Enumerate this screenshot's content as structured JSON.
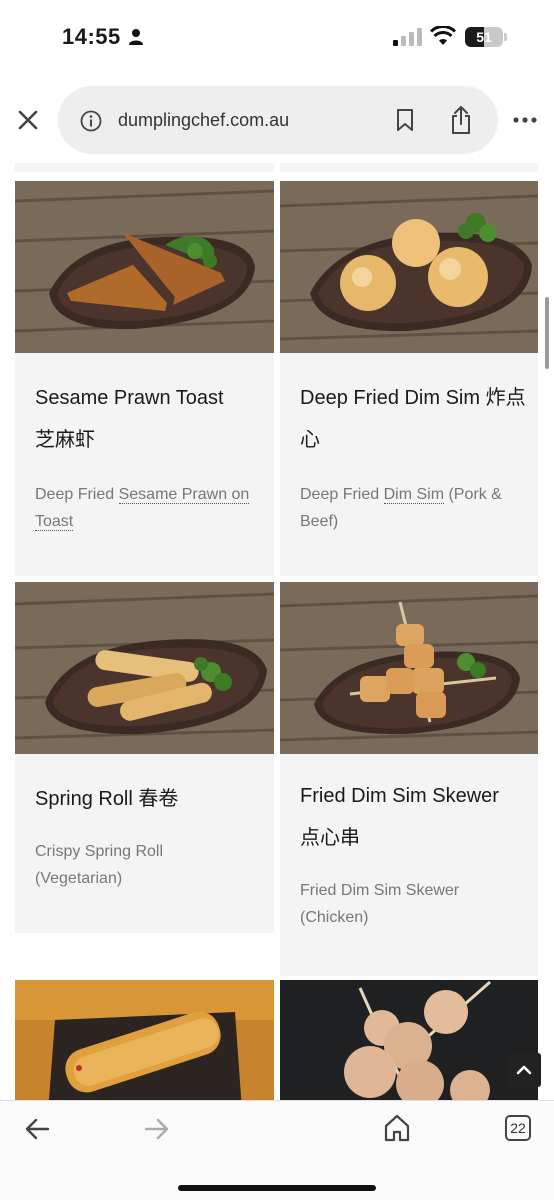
{
  "status": {
    "time": "14:55",
    "battery": "51",
    "battery_level": 0.51,
    "icons": [
      "person-icon",
      "signal-icon",
      "wifi-icon",
      "battery-icon"
    ]
  },
  "browser": {
    "url": "dumplingchef.com.au",
    "tabs_count": "22",
    "icons": [
      "close-icon",
      "info-icon",
      "bookmark-icon",
      "share-icon",
      "more-icon",
      "back-arrow-icon",
      "forward-arrow-icon",
      "home-icon",
      "scroll-top-icon"
    ]
  },
  "menu": {
    "items": [
      {
        "title": "Sesame Prawn Toast",
        "title_cn": "芝麻虾",
        "desc_prefix": "Deep Fried ",
        "desc_link": "Sesame Prawn on Toast",
        "desc_suffix": ""
      },
      {
        "title": "Deep Fried Dim Sim",
        "title_cn": "炸点心",
        "desc_prefix": "Deep Fried ",
        "desc_link": "Dim Sim",
        "desc_suffix": " (Pork & Beef)"
      },
      {
        "title": "Spring Roll",
        "title_cn": "春卷",
        "desc": "Crispy Spring Roll (Vegetarian)"
      },
      {
        "title": "Fried Dim Sim Skewer",
        "title_cn": "点心串",
        "desc": "Fried Dim Sim Skewer (Chicken)"
      }
    ]
  },
  "colors": {
    "card_bg": "#f4f4f4",
    "title": "#1a1a1a",
    "desc": "#777777",
    "url_pill": "#eeeeee"
  }
}
